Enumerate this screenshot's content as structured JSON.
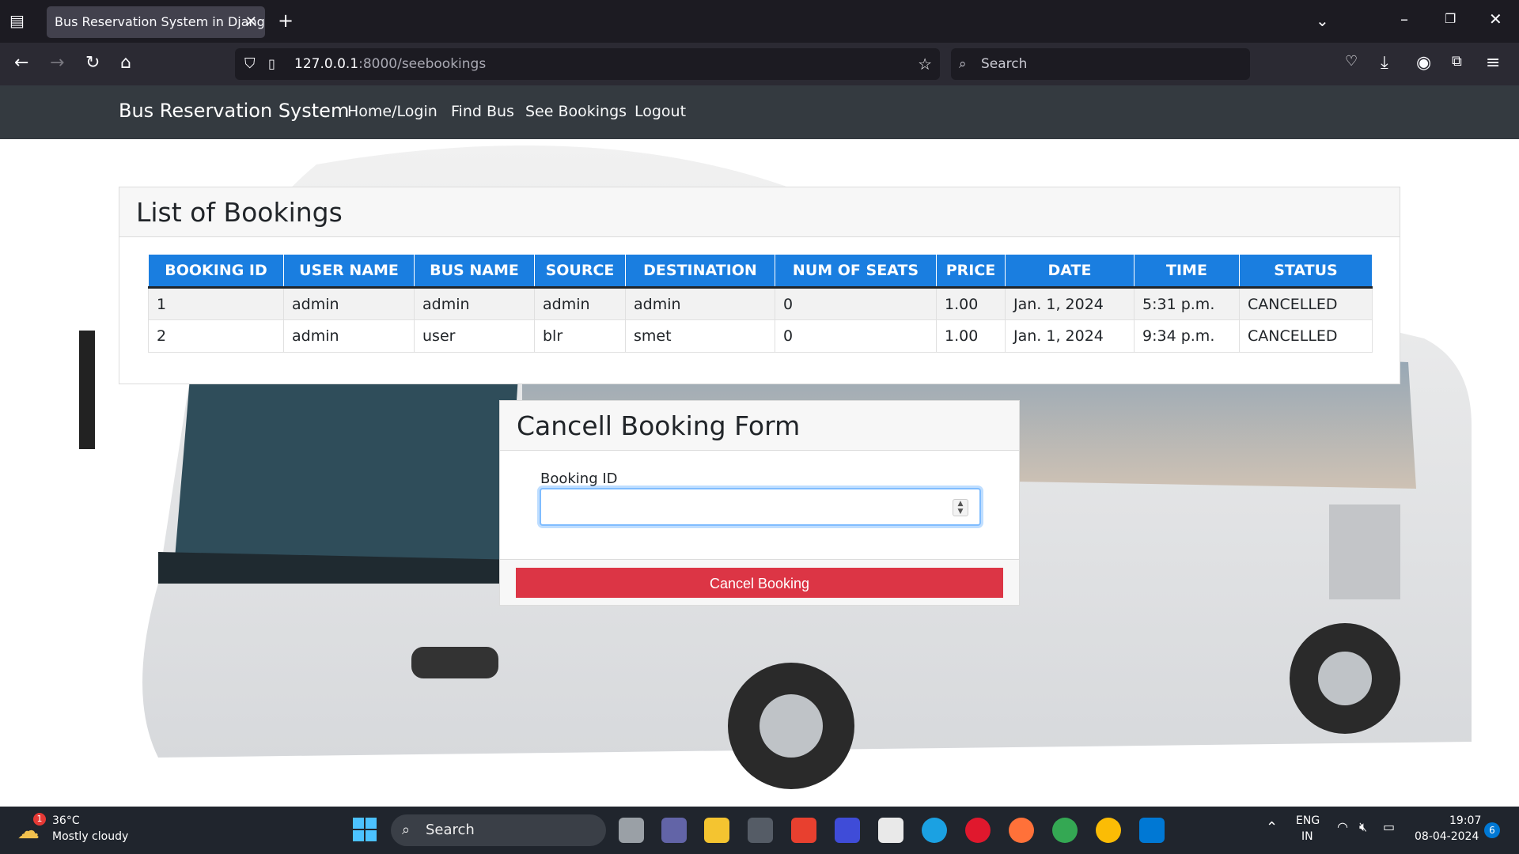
{
  "browser": {
    "tab_title": "Bus Reservation System in Django F",
    "url_host": "127.0.0.1",
    "url_path": ":8000/seebookings",
    "search_placeholder": "Search"
  },
  "navbar": {
    "brand": "Bus Reservation System",
    "links": [
      "Home/Login",
      "Find Bus",
      "See Bookings",
      "Logout"
    ]
  },
  "bookings": {
    "title": "List of Bookings",
    "columns": [
      "BOOKING ID",
      "USER NAME",
      "BUS NAME",
      "SOURCE",
      "DESTINATION",
      "NUM OF SEATS",
      "PRICE",
      "DATE",
      "TIME",
      "STATUS"
    ],
    "rows": [
      [
        "1",
        "admin",
        "admin",
        "admin",
        "admin",
        "0",
        "1.00",
        "Jan. 1, 2024",
        "5:31 p.m.",
        "CANCELLED"
      ],
      [
        "2",
        "admin",
        "user",
        "blr",
        "smet",
        "0",
        "1.00",
        "Jan. 1, 2024",
        "9:34 p.m.",
        "CANCELLED"
      ]
    ]
  },
  "cancel_form": {
    "title": "Cancell Booking Form",
    "field_label": "Booking ID",
    "button_label": "Cancel Booking"
  },
  "taskbar": {
    "weather_temp": "36°C",
    "weather_desc": "Mostly cloudy",
    "weather_badge": "1",
    "search_label": "Search",
    "lang_top": "ENG",
    "lang_bottom": "IN",
    "time": "19:07",
    "date": "08-04-2024",
    "notif_count": "6"
  },
  "colors": {
    "navbar_bg": "#343a40",
    "table_header_bg": "#1a7ee0",
    "danger_button": "#dc3545",
    "browser_chrome": "#1c1b22"
  }
}
